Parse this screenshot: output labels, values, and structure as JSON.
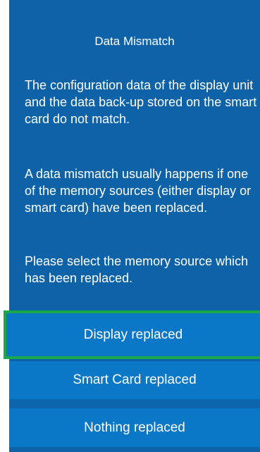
{
  "dialog": {
    "title": "Data Mismatch",
    "paragraphs": [
      "The configuration data of the display unit and the data back-up stored on the smart card do not match.",
      "A data mismatch usually happens if one of the memory sources (either display or smart card) have been replaced.",
      "Please select the memory source which has been replaced."
    ]
  },
  "options": [
    {
      "label": "Display replaced",
      "selected": true
    },
    {
      "label": "Smart Card replaced",
      "selected": false
    },
    {
      "label": "Nothing replaced",
      "selected": false
    }
  ],
  "colors": {
    "panel": "#0e62a8",
    "button": "#0a77c7",
    "selection_border": "#1aa84a",
    "text": "#ffffff"
  }
}
